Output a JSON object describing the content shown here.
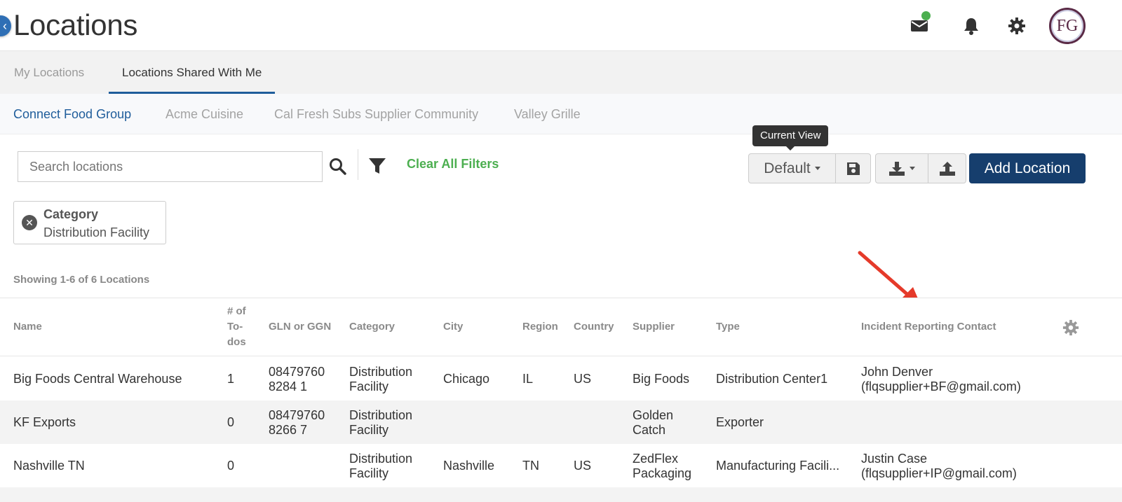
{
  "header": {
    "title": "Locations",
    "back_icon": "chevron-left-icon",
    "icons": [
      "mail-icon",
      "bell-icon",
      "gear-icon"
    ],
    "avatar_text": "FG",
    "colors": {
      "accent": "#1f5d9b",
      "primary_button": "#163e6d",
      "success": "#4caf50"
    }
  },
  "main_tabs": [
    {
      "label": "My Locations",
      "active": false
    },
    {
      "label": "Locations Shared With Me",
      "active": true
    }
  ],
  "sub_tabs": [
    {
      "label": "Connect Food Group",
      "active": true
    },
    {
      "label": "Acme Cuisine",
      "active": false
    },
    {
      "label": "Cal Fresh Subs Supplier Community",
      "active": false
    },
    {
      "label": "Valley Grille",
      "active": false
    }
  ],
  "toolbar": {
    "search_placeholder": "Search locations",
    "clear_filters_label": "Clear All Filters",
    "view_tooltip": "Current View",
    "view_label": "Default",
    "add_location_label": "Add Location"
  },
  "filter_chip": {
    "label": "Category",
    "value": "Distribution Facility"
  },
  "results_summary": "Showing 1-6 of 6 Locations",
  "table": {
    "columns": [
      "Name",
      "# of To-dos",
      "GLN or GGN",
      "Category",
      "City",
      "Region",
      "Country",
      "Supplier",
      "Type",
      "Incident Reporting Contact"
    ],
    "rows": [
      {
        "name": "Big Foods Central Warehouse",
        "todos": "1",
        "gln": [
          "08479760",
          "8284 1"
        ],
        "category": [
          "Distribution",
          "Facility"
        ],
        "city": "Chicago",
        "region": "IL",
        "country": "US",
        "supplier": [
          "Big Foods"
        ],
        "type": "Distribution Center1",
        "contact": [
          "John Denver",
          "(flqsupplier+BF@gmail.com)"
        ]
      },
      {
        "name": "KF Exports",
        "todos": "0",
        "gln": [
          "08479760",
          "8266 7"
        ],
        "category": [
          "Distribution",
          "Facility"
        ],
        "city": "",
        "region": "",
        "country": "",
        "supplier": [
          "Golden",
          "Catch"
        ],
        "type": "Exporter",
        "contact": [
          "",
          ""
        ]
      },
      {
        "name": "Nashville TN",
        "todos": "0",
        "gln": [
          "",
          ""
        ],
        "category": [
          "Distribution",
          "Facility"
        ],
        "city": "Nashville",
        "region": "TN",
        "country": "US",
        "supplier": [
          "ZedFlex",
          "Packaging"
        ],
        "type": "Manufacturing Facili...",
        "contact": [
          "Justin Case",
          "(flqsupplier+IP@gmail.com)"
        ]
      }
    ]
  }
}
